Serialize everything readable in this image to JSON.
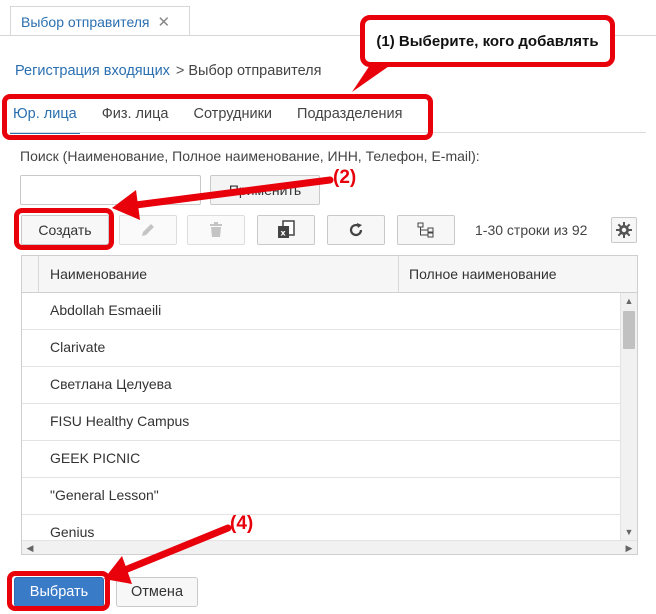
{
  "window_tab": {
    "title": "Выбор отправителя",
    "close": "✕"
  },
  "breadcrumb": {
    "link": "Регистрация входящих",
    "separator": ">",
    "current": "Выбор отправителя"
  },
  "entity_tabs": [
    {
      "label": "Юр. лица",
      "active": true
    },
    {
      "label": "Физ. лица",
      "active": false
    },
    {
      "label": "Сотрудники",
      "active": false
    },
    {
      "label": "Подразделения",
      "active": false
    }
  ],
  "search": {
    "label": "Поиск (Наименование, Полное наименование, ИНН, Телефон, E-mail):",
    "value": "",
    "apply_label": "Применить"
  },
  "toolbar": {
    "create_label": "Создать",
    "range_text": "1-30 строки из  92"
  },
  "table": {
    "columns": [
      "Наименование",
      "Полное наименование"
    ],
    "rows": [
      "Abdollah Esmaeili",
      "Clarivate",
      "Светлана Целуева",
      "FISU Healthy Campus",
      "GEEK PICNIC",
      "\"General Lesson\"",
      "Genius"
    ]
  },
  "footer": {
    "select_label": "Выбрать",
    "cancel_label": "Отмена"
  },
  "annotations": {
    "callout_1": "(1) Выберите, кого добавлять",
    "step_2": "(2)",
    "step_4": "(4)",
    "color": "#e8000b"
  }
}
